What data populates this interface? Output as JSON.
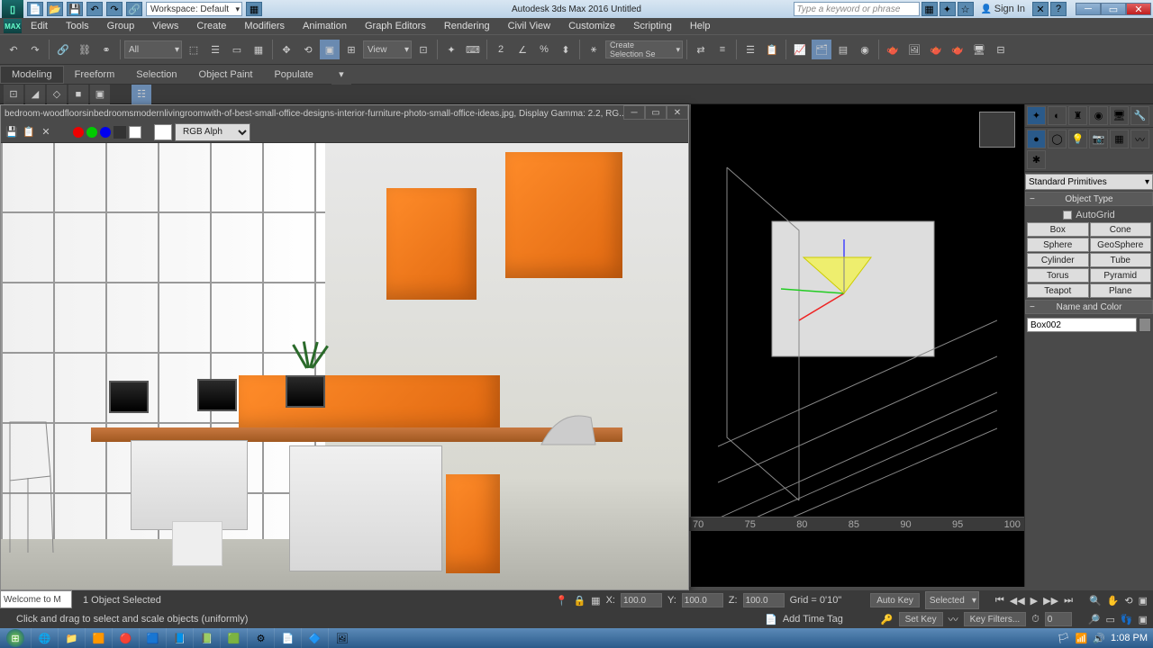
{
  "app": {
    "title": "Autodesk 3ds Max 2016   Untitled",
    "workspace": "Workspace: Default",
    "search_placeholder": "Type a keyword or phrase",
    "sign_in": "Sign In"
  },
  "menu": [
    "Edit",
    "Tools",
    "Group",
    "Views",
    "Create",
    "Modifiers",
    "Animation",
    "Graph Editors",
    "Rendering",
    "Civil View",
    "Customize",
    "Scripting",
    "Help"
  ],
  "toolbar": {
    "filter": "All",
    "view": "View",
    "selset": "Create Selection Se"
  },
  "ribbon": {
    "tabs": [
      "Modeling",
      "Freeform",
      "Selection",
      "Object Paint",
      "Populate"
    ],
    "active": 0
  },
  "image_window": {
    "title": "bedroom-woodfloorsinbedroomsmodernlivingroomwith-of-best-small-office-designs-interior-furniture-photo-small-office-ideas.jpg, Display Gamma: 2.2, RG...",
    "channel": "RGB Alpha"
  },
  "command_panel": {
    "category": "Standard Primitives",
    "object_type_label": "Object Type",
    "autogrid": "AutoGrid",
    "buttons": [
      [
        "Box",
        "Cone"
      ],
      [
        "Sphere",
        "GeoSphere"
      ],
      [
        "Cylinder",
        "Tube"
      ],
      [
        "Torus",
        "Pyramid"
      ],
      [
        "Teapot",
        "Plane"
      ]
    ],
    "name_color_label": "Name and Color",
    "object_name": "Box002"
  },
  "status": {
    "selection": "1 Object Selected",
    "prompt": "Click and drag to select and scale objects (uniformly)",
    "x": "100.0",
    "y": "100.0",
    "z": "100.0",
    "grid": "Grid = 0'10\"",
    "autokey": "Auto Key",
    "selected": "Selected",
    "setkey": "Set Key",
    "keyfilters": "Key Filters...",
    "frame": "0",
    "addtag": "Add Time Tag",
    "maxscript": "Welcome to M"
  },
  "timeline": {
    "ticks": [
      "70",
      "75",
      "80",
      "85",
      "90",
      "95",
      "100"
    ]
  },
  "taskbar": {
    "time": "1:08 PM"
  }
}
